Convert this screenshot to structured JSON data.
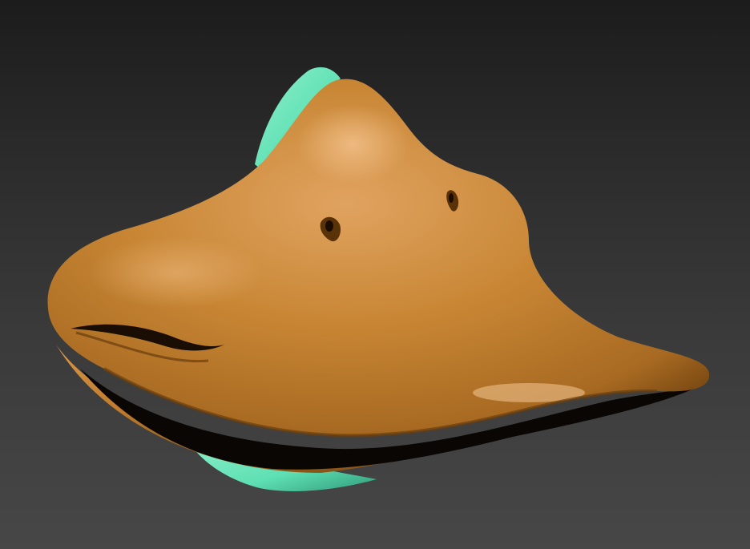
{
  "scene": {
    "subject": "duck-beak-model",
    "colors": {
      "background_top": "#1c1c1c",
      "background_bottom": "#474747",
      "beak_base": "#c3802f",
      "beak_highlight": "#e3a969",
      "beak_shadow": "#7a4912",
      "crease": "#000000",
      "teal_part": "#5fe0b4",
      "teal_shadow": "#2f9a78"
    }
  }
}
